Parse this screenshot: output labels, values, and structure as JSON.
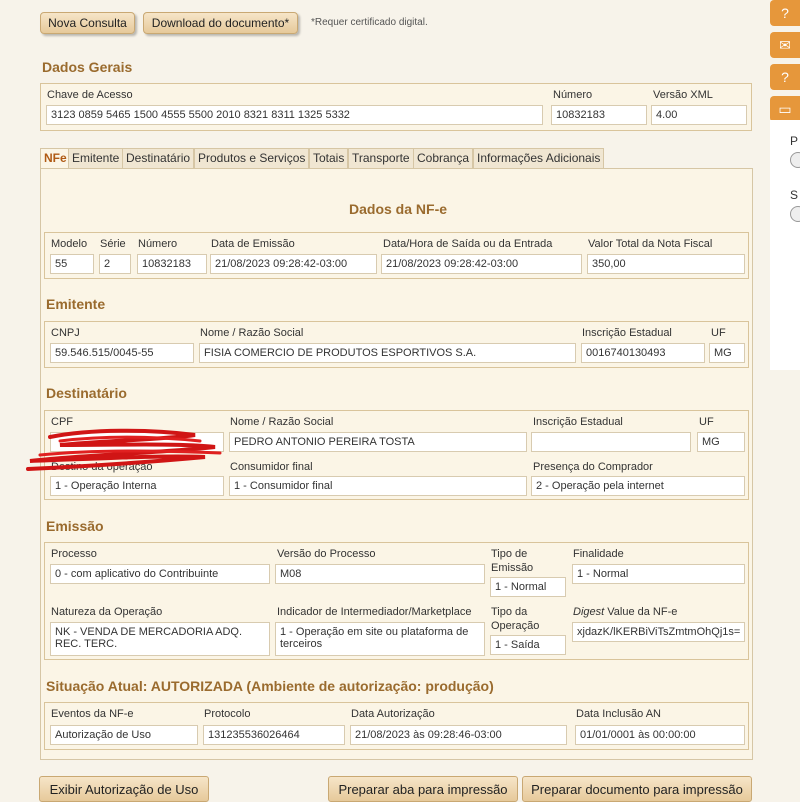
{
  "toolbar": {
    "new_query": "Nova Consulta",
    "download": "Download do documento*",
    "note": "*Requer certificado digital."
  },
  "dados_gerais": {
    "title": "Dados Gerais",
    "chave_label": "Chave de Acesso",
    "chave_value": "3123 0859 5465 1500 4555 5500 2010 8321 8311 1325 5332",
    "numero_label": "Número",
    "numero_value": "10832183",
    "versao_label": "Versão XML",
    "versao_value": "4.00"
  },
  "tabs": [
    "NFe",
    "Emitente",
    "Destinatário",
    "Produtos e Serviços",
    "Totais",
    "Transporte",
    "Cobrança",
    "Informações Adicionais"
  ],
  "nfe": {
    "title": "Dados da NF-e",
    "modelo_label": "Modelo",
    "modelo_value": "55",
    "serie_label": "Série",
    "serie_value": "2",
    "numero_label": "Número",
    "numero_value": "10832183",
    "emissao_label": "Data de Emissão",
    "emissao_value": "21/08/2023 09:28:42-03:00",
    "saida_label": "Data/Hora de Saída ou da Entrada",
    "saida_value": "21/08/2023 09:28:42-03:00",
    "total_label": "Valor Total da Nota Fiscal",
    "total_value": "350,00"
  },
  "emitente": {
    "title": "Emitente",
    "cnpj_label": "CNPJ",
    "cnpj_value": "59.546.515/0045-55",
    "nome_label": "Nome / Razão Social",
    "nome_value": "FISIA COMERCIO DE PRODUTOS ESPORTIVOS S.A.",
    "ie_label": "Inscrição Estadual",
    "ie_value": "0016740130493",
    "uf_label": "UF",
    "uf_value": "MG"
  },
  "destinatario": {
    "title": "Destinatário",
    "cpf_label": "CPF",
    "cpf_value": "",
    "nome_label": "Nome / Razão Social",
    "nome_value": "PEDRO ANTONIO PEREIRA TOSTA",
    "ie_label": "Inscrição Estadual",
    "ie_value": "",
    "uf_label": "UF",
    "uf_value": "MG",
    "destino_label": "Destino da operação",
    "destino_value": "1 - Operação Interna",
    "consumidor_label": "Consumidor final",
    "consumidor_value": "1 - Consumidor final",
    "presenca_label": "Presença do Comprador",
    "presenca_value": "2 - Operação pela internet"
  },
  "emissao": {
    "title": "Emissão",
    "processo_label": "Processo",
    "processo_value": "0 - com aplicativo do Contribuinte",
    "versao_label": "Versão do Processo",
    "versao_value": "M08",
    "tipo_label_1": "Tipo de",
    "tipo_label_2": "Emissão",
    "tipo_value": "1 - Normal",
    "finalidade_label": "Finalidade",
    "finalidade_value": "1 - Normal",
    "natureza_label": "Natureza da Operação",
    "natureza_value_1": "NK - VENDA DE MERCADORIA ADQ.",
    "natureza_value_2": "REC. TERC.",
    "intermediador_label": "Indicador de Intermediador/Marketplace",
    "intermediador_value_1": "1 - Operação em site ou plataforma de",
    "intermediador_value_2": "terceiros",
    "tipoop_label_1": "Tipo da",
    "tipoop_label_2": "Operação",
    "tipoop_value": "1 - Saída",
    "digest_label_em": "Digest",
    "digest_label_rest": " Value da NF-e",
    "digest_value": "xjdazK/lKERBiViTsZmtmOhQj1s="
  },
  "situacao": {
    "title": "Situação Atual: AUTORIZADA (Ambiente de autorização: produção)",
    "eventos_label": "Eventos da NF-e",
    "eventos_value": "Autorização de Uso",
    "protocolo_label": "Protocolo",
    "protocolo_value": "131235536026464",
    "data_aut_label": "Data Autorização",
    "data_aut_value": "21/08/2023 às 09:28:46-03:00",
    "data_inc_label": "Data Inclusão AN",
    "data_inc_value": "01/01/0001 às 00:00:00"
  },
  "bottom": {
    "exibir": "Exibir Autorização de Uso",
    "preparar_aba": "Preparar aba para impressão",
    "preparar_doc": "Preparar documento para impressão"
  },
  "sidebar": {
    "p_label": "P",
    "s_label": "S"
  },
  "colors": {
    "accent": "#9a6b2e",
    "orange": "#e6973b",
    "panel": "#fbf5e6"
  },
  "icons": [
    "question-icon",
    "mail-icon",
    "help-icon",
    "window-icon"
  ]
}
